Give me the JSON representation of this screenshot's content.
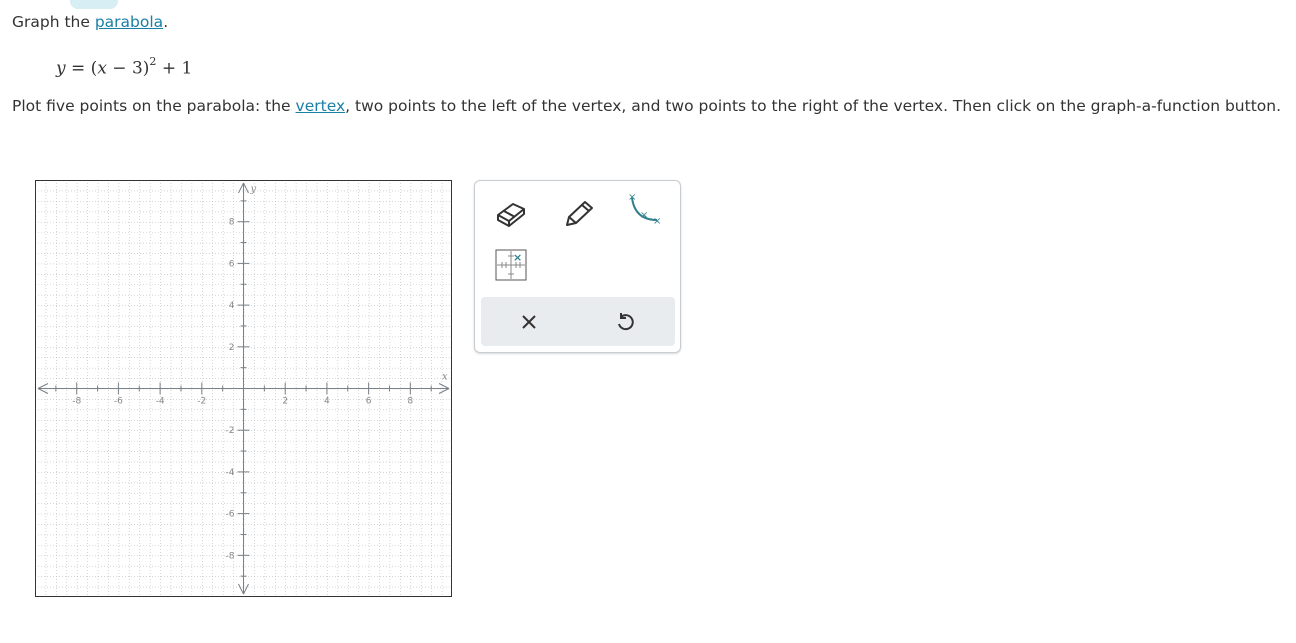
{
  "prompt": {
    "prefix": "Graph the ",
    "link": "parabola",
    "suffix": "."
  },
  "equation": {
    "lhs": "y",
    "eq": " = ",
    "open": "(",
    "x": "x",
    "minus": " − 3",
    "close": ")",
    "exp": "2",
    "plus": " + 1"
  },
  "instructions": {
    "part1": "Plot five points on the parabola: the ",
    "link": "vertex",
    "part2": ", two points to the left of the vertex, and two points to the right of the vertex. Then click on the graph-a-function button."
  },
  "graph": {
    "x_label": "x",
    "y_label": "y",
    "x_range": [
      -10,
      10
    ],
    "y_range": [
      -10,
      10
    ],
    "x_tick_labels": [
      "-8",
      "-6",
      "-4",
      "-2",
      "2",
      "4",
      "6",
      "8"
    ],
    "y_tick_labels": [
      "8",
      "6",
      "4",
      "2",
      "-2",
      "-4",
      "-6",
      "-8"
    ],
    "grid": true,
    "colors": {
      "grid": "#b9bfc4",
      "axis": "#7a8288",
      "border": "#333333",
      "label": "#888888"
    }
  },
  "toolbox": {
    "tools": [
      {
        "name": "eraser-icon",
        "title": "Eraser"
      },
      {
        "name": "pencil-icon",
        "title": "Draw"
      },
      {
        "name": "graph-function-icon",
        "title": "Graph a function"
      },
      {
        "name": "point-plot-icon",
        "title": "Plot point"
      }
    ],
    "actions": [
      {
        "name": "clear-icon",
        "glyph": "×"
      },
      {
        "name": "undo-icon",
        "glyph": "↺"
      }
    ],
    "accent": "#2f7f8c"
  }
}
